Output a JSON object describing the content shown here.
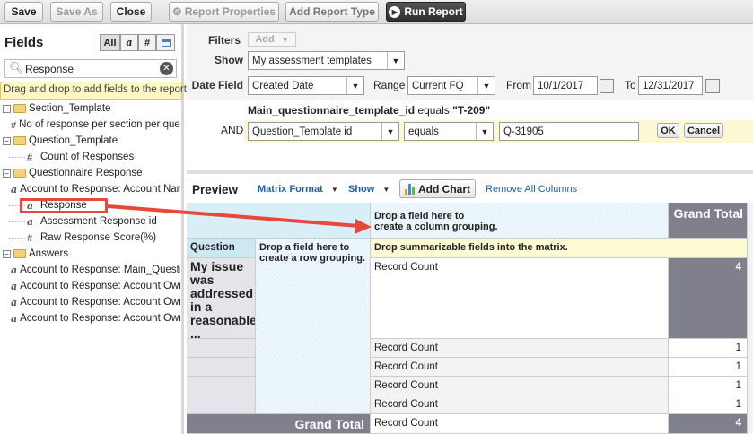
{
  "toolbar": {
    "save": "Save",
    "save_as": "Save As",
    "close": "Close",
    "report_properties": "Report Properties",
    "add_report_type": "Add Report Type",
    "run_report": "Run Report"
  },
  "fields": {
    "title": "Fields",
    "filters": [
      "All",
      "a",
      "#",
      "cal"
    ],
    "search_value": "Response",
    "hint": "Drag and drop to add fields to the report.",
    "tree": [
      {
        "type": "folder",
        "label": "Section_Template"
      },
      {
        "type": "number",
        "label": "No of response per section per question"
      },
      {
        "type": "folder",
        "label": "Question_Template"
      },
      {
        "type": "number",
        "label": "Count of Responses"
      },
      {
        "type": "folder",
        "label": "Questionnaire Response"
      },
      {
        "type": "text",
        "label": "Account to Response: Account Name"
      },
      {
        "type": "text",
        "label": "Response"
      },
      {
        "type": "text",
        "label": "Assessment Response id"
      },
      {
        "type": "number",
        "label": "Raw Response Score(%)"
      },
      {
        "type": "folder",
        "label": "Answers"
      },
      {
        "type": "text",
        "label": "Account to Response: Main_Questionnaire"
      },
      {
        "type": "text",
        "label": "Account to Response: Account Owner"
      },
      {
        "type": "text",
        "label": "Account to Response: Account Owner"
      },
      {
        "type": "text",
        "label": "Account to Response: Account Owner"
      }
    ]
  },
  "filters": {
    "filters_label": "Filters",
    "add": "Add",
    "show_label": "Show",
    "show_value": "My assessment templates",
    "date_field_label": "Date Field",
    "date_field_value": "Created Date",
    "range_label": "Range",
    "range_value": "Current FQ",
    "from_label": "From",
    "from_value": "10/1/2017",
    "to_label": "To",
    "to_value": "12/31/2017",
    "condition_field": "Main_questionnaire_template_id",
    "condition_op": "equals",
    "condition_value": "\"T-209\"",
    "and_label": "AND",
    "and_field": "Question_Template id",
    "and_op": "equals",
    "and_value": "Q-31905",
    "ok": "OK",
    "cancel": "Cancel"
  },
  "preview": {
    "title": "Preview",
    "format": "Matrix Format",
    "show": "Show",
    "add_chart": "Add Chart",
    "remove_all": "Remove All Columns",
    "col_drop": [
      "Drop a field here to",
      "create a column grouping."
    ],
    "grand_total": "Grand Total",
    "question_header": "Question",
    "question_value": "My issue was addressed in a reasonable ...",
    "row_drop": "Drop a field here to create a row grouping.",
    "summ_hint": "Drop summarizable fields into the matrix.",
    "rows": [
      {
        "label": "Record Count",
        "value": "4"
      },
      {
        "label": "Record Count",
        "value": "1"
      },
      {
        "label": "Record Count",
        "value": "1"
      },
      {
        "label": "Record Count",
        "value": "1"
      },
      {
        "label": "Record Count",
        "value": "1"
      }
    ],
    "grand_row": {
      "label": "Grand Total",
      "metric": "Record Count",
      "value": "4"
    }
  },
  "colors": {
    "highlight": "#e8473a",
    "grand_total_bg": "#80808c",
    "link": "#1f5ea8"
  }
}
